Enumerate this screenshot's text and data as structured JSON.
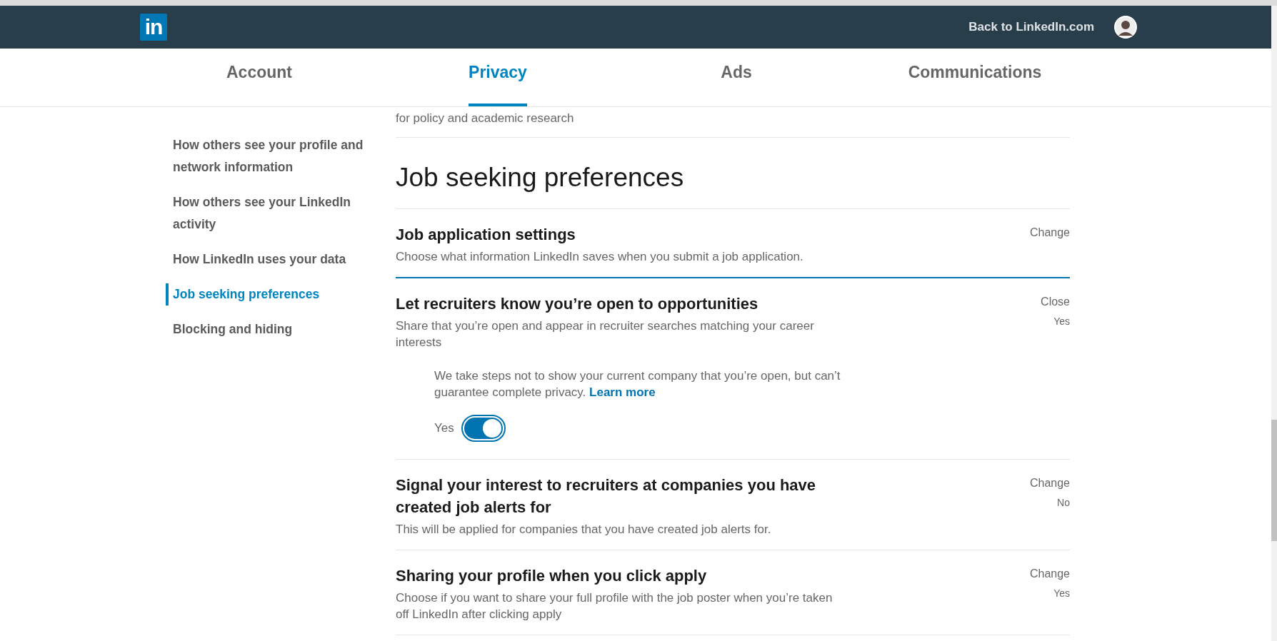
{
  "header": {
    "back_link": "Back to LinkedIn.com",
    "logo": "in"
  },
  "tabs": [
    {
      "label": "Account",
      "selected": false
    },
    {
      "label": "Privacy",
      "selected": true
    },
    {
      "label": "Ads",
      "selected": false
    },
    {
      "label": "Communications",
      "selected": false
    }
  ],
  "sidebar": {
    "items": [
      {
        "label": "How others see your profile and network information",
        "selected": false
      },
      {
        "label": "How others see your LinkedIn activity",
        "selected": false
      },
      {
        "label": "How LinkedIn uses your data",
        "selected": false
      },
      {
        "label": "Job seeking preferences",
        "selected": true
      },
      {
        "label": "Blocking and hiding",
        "selected": false
      }
    ]
  },
  "previous_section_tail": "for policy and academic research",
  "section": {
    "title": "Job seeking preferences",
    "settings": [
      {
        "title": "Job application settings",
        "description": "Choose what information LinkedIn saves when you submit a job application.",
        "action": "Change",
        "expanded": false
      },
      {
        "title": "Let recruiters know you’re open to opportunities",
        "description": "Share that you’re open and appear in recruiter searches matching your career interests",
        "action": "Close",
        "value": "Yes",
        "expanded": true,
        "note": "We take steps not to show your current company that you’re open, but can’t guarantee complete privacy.",
        "note_link": "Learn more",
        "toggle_label": "Yes",
        "toggle_on": true
      },
      {
        "title": "Signal your interest to recruiters at companies you have created job alerts for",
        "description": "This will be applied for companies that you have created job alerts for.",
        "action": "Change",
        "value": "No",
        "expanded": false
      },
      {
        "title": "Sharing your profile when you click apply",
        "description": "Choose if you want to share your full profile with the job poster when you’re taken off LinkedIn after clicking apply",
        "action": "Change",
        "value": "Yes",
        "expanded": false
      }
    ]
  }
}
